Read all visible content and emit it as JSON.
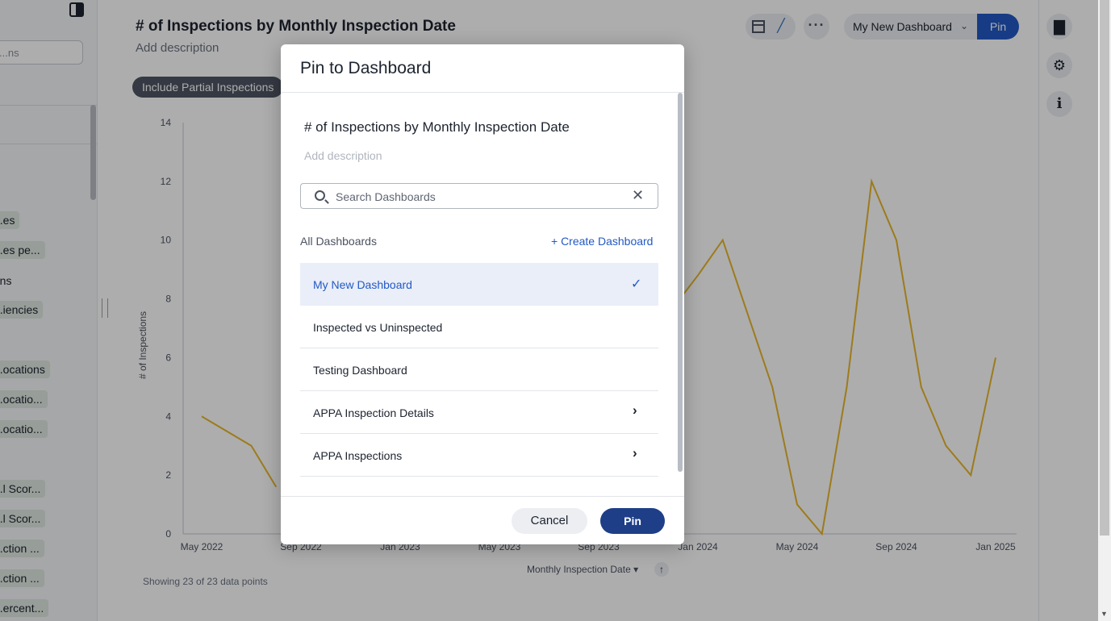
{
  "left_panel": {
    "search_placeholder": "...ns",
    "chips": [
      {
        "label": "...es",
        "kind": "chip"
      },
      {
        "label": "...es pe...",
        "kind": "chip"
      },
      {
        "label": "...ns",
        "kind": "plain"
      },
      {
        "label": "...iencies",
        "kind": "chip"
      },
      {
        "label": "...ocations",
        "kind": "chip"
      },
      {
        "label": "...ocatio...",
        "kind": "chip"
      },
      {
        "label": "...ocatio...",
        "kind": "chip"
      },
      {
        "label": "...l Scor...",
        "kind": "chip"
      },
      {
        "label": "...l Scor...",
        "kind": "chip"
      },
      {
        "label": "...ction ...",
        "kind": "chip"
      },
      {
        "label": "...ction ...",
        "kind": "chip"
      },
      {
        "label": "...ercent...",
        "kind": "chip"
      }
    ]
  },
  "header": {
    "title": "# of Inspections by Monthly Inspection Date",
    "description": "Add description",
    "filter_chip": "Include Partial Inspections",
    "dashboard_select": "My New Dashboard",
    "pin_label": "Pin"
  },
  "chart_data": {
    "type": "line",
    "x": [
      "2022-05",
      "2022-06",
      "2022-07",
      "2022-08",
      "2022-09",
      "2022-10",
      "2022-11",
      "2022-12",
      "2023-01",
      "2023-02",
      "2023-03",
      "2023-04",
      "2023-05",
      "2023-06",
      "2023-07",
      "2023-08",
      "2023-09",
      "2023-10",
      "2023-11",
      "2023-12",
      "2024-01",
      "2024-02",
      "2024-03",
      "2024-04",
      "2024-05",
      "2024-06",
      "2024-07",
      "2024-08",
      "2024-09",
      "2024-10",
      "2024-11",
      "2024-12",
      "2025-01"
    ],
    "series": [
      {
        "values": [
          4,
          3.5,
          3,
          1.6,
          null,
          null,
          null,
          null,
          null,
          null,
          null,
          null,
          null,
          null,
          null,
          null,
          null,
          null,
          null,
          7.7,
          8.8,
          10,
          7.5,
          5,
          1,
          0,
          5,
          12,
          10,
          5,
          3,
          2,
          6
        ]
      }
    ],
    "ylim": [
      0,
      14
    ],
    "yticks": [
      0,
      2,
      4,
      6,
      8,
      10,
      12,
      14
    ],
    "xticks": [
      "May 2022",
      "Sep 2022",
      "Jan 2023",
      "May 2023",
      "Sep 2023",
      "Jan 2024",
      "May 2024",
      "Sep 2024",
      "Jan 2025"
    ],
    "ylabel": "# of Inspections",
    "xlabel": "Monthly Inspection Date",
    "line_color": "#e8b52a",
    "footer": "Showing 23 of 23 data points"
  },
  "modal": {
    "title": "Pin to Dashboard",
    "viz_title": "# of Inspections by Monthly Inspection Date",
    "viz_description_placeholder": "Add description",
    "search_placeholder": "Search Dashboards",
    "section_label": "All Dashboards",
    "create_label": "+ Create Dashboard",
    "dashboards": [
      {
        "name": "My New Dashboard",
        "selected": true,
        "has_children": false
      },
      {
        "name": "Inspected vs Uninspected",
        "selected": false,
        "has_children": false
      },
      {
        "name": "Testing Dashboard",
        "selected": false,
        "has_children": false
      },
      {
        "name": "APPA Inspection Details",
        "selected": false,
        "has_children": true
      },
      {
        "name": "APPA Inspections",
        "selected": false,
        "has_children": true
      }
    ],
    "cancel_label": "Cancel",
    "pin_label": "Pin"
  },
  "colors": {
    "accent": "#2359c4",
    "primary_button": "#1e3f87",
    "selected_row": "#e9eef8"
  }
}
